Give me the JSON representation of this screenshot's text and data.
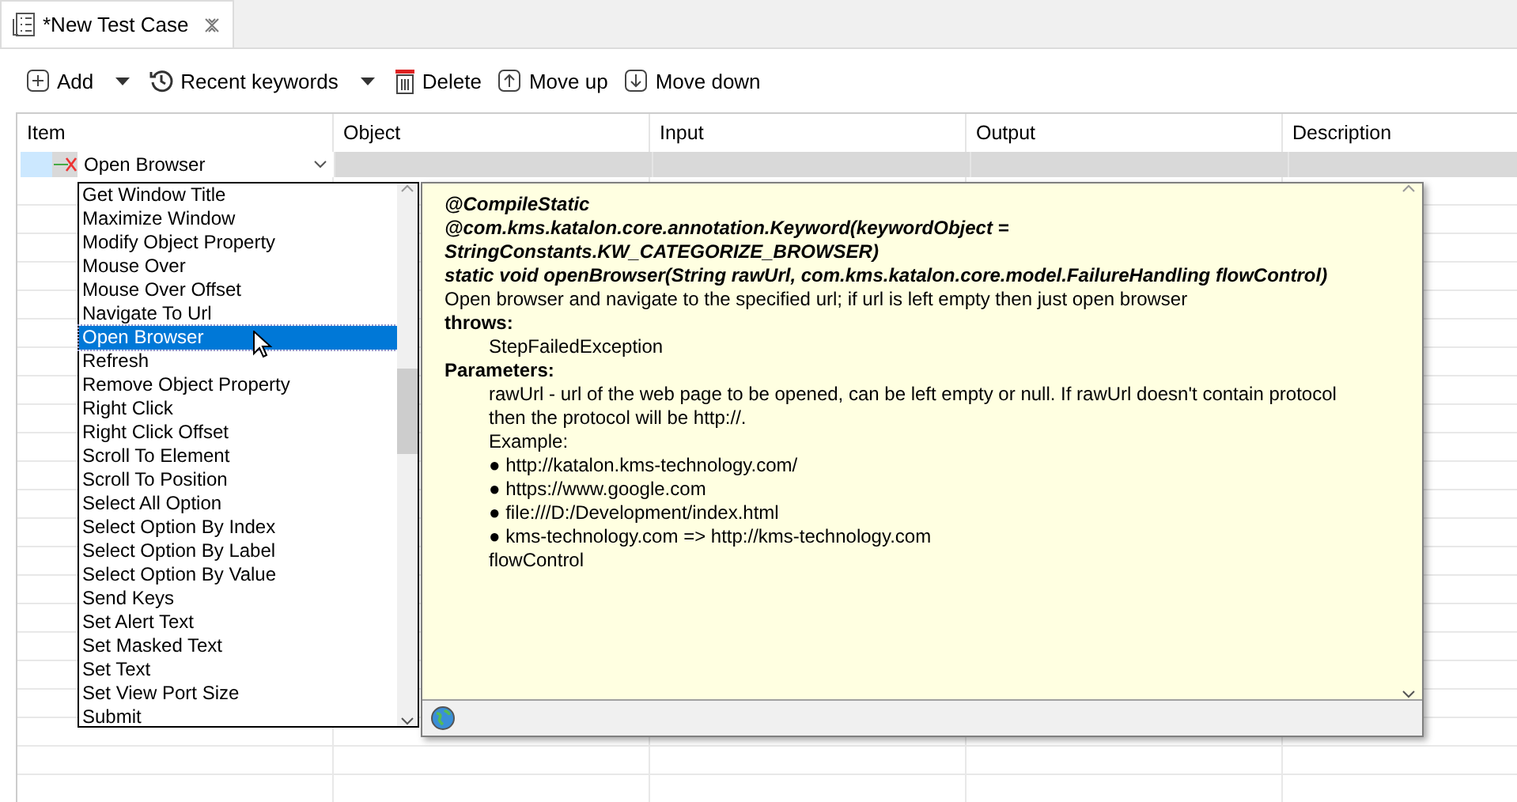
{
  "tab": {
    "title": "*New Test Case",
    "selected": true
  },
  "toolbar": [
    {
      "kind": "add",
      "label": "Add",
      "dropdown": true
    },
    {
      "kind": "history",
      "label": "Recent keywords",
      "dropdown": true
    },
    {
      "kind": "delete",
      "label": "Delete",
      "dropdown": false
    },
    {
      "kind": "up",
      "label": "Move up",
      "dropdown": false
    },
    {
      "kind": "down",
      "label": "Move down",
      "dropdown": false
    }
  ],
  "table": {
    "columns": [
      "Item",
      "Object",
      "Input",
      "Output",
      "Description"
    ],
    "rows": [
      {
        "item": "Open Browser"
      }
    ]
  },
  "keyword_list": {
    "items": [
      {
        "label": "Get Window Title",
        "selected": false
      },
      {
        "label": "Maximize Window",
        "selected": false
      },
      {
        "label": "Modify Object Property",
        "selected": false
      },
      {
        "label": "Mouse Over",
        "selected": false
      },
      {
        "label": "Mouse Over Offset",
        "selected": false
      },
      {
        "label": "Navigate To Url",
        "selected": false
      },
      {
        "label": "Open Browser",
        "selected": true
      },
      {
        "label": "Refresh",
        "selected": false
      },
      {
        "label": "Remove Object Property",
        "selected": false
      },
      {
        "label": "Right Click",
        "selected": false
      },
      {
        "label": "Right Click Offset",
        "selected": false
      },
      {
        "label": "Scroll To Element",
        "selected": false
      },
      {
        "label": "Scroll To Position",
        "selected": false
      },
      {
        "label": "Select All Option",
        "selected": false
      },
      {
        "label": "Select Option By Index",
        "selected": false
      },
      {
        "label": "Select Option By Label",
        "selected": false
      },
      {
        "label": "Select Option By Value",
        "selected": false
      },
      {
        "label": "Send Keys",
        "selected": false
      },
      {
        "label": "Set Alert Text",
        "selected": false
      },
      {
        "label": "Set Masked Text",
        "selected": false
      },
      {
        "label": "Set Text",
        "selected": false
      },
      {
        "label": "Set View Port Size",
        "selected": false
      },
      {
        "label": "Submit",
        "selected": false
      }
    ]
  },
  "doc": {
    "lines": [
      {
        "kind": "signature",
        "text": "@CompileStatic"
      },
      {
        "kind": "signature",
        "text": "@com.kms.katalon.core.annotation.Keyword(keywordObject ="
      },
      {
        "kind": "signature",
        "text": "StringConstants.KW_CATEGORIZE_BROWSER)"
      },
      {
        "kind": "signature",
        "text": "static void openBrowser(String rawUrl, com.kms.katalon.core.model.FailureHandling flowControl)"
      },
      {
        "kind": "text",
        "text": "Open browser and navigate to the specified url; if url is left empty then just open browser"
      },
      {
        "kind": "heading",
        "text": "throws:"
      },
      {
        "kind": "indented",
        "text": "StepFailedException"
      },
      {
        "kind": "heading",
        "text": "Parameters:"
      },
      {
        "kind": "indented",
        "text": "rawUrl - url of the web page to be opened, can be left empty or null. If rawUrl doesn't contain protocol"
      },
      {
        "kind": "indented",
        "text": "then the protocol will be http://."
      },
      {
        "kind": "indented",
        "text": "Example:"
      },
      {
        "kind": "indented",
        "text": "● http://katalon.kms-technology.com/"
      },
      {
        "kind": "indented",
        "text": "● https://www.google.com"
      },
      {
        "kind": "indented",
        "text": "● file:///D:/Development/index.html"
      },
      {
        "kind": "indented",
        "text": "● kms-technology.com => http://kms-technology.com"
      },
      {
        "kind": "indented",
        "text": "flowControl"
      }
    ]
  }
}
